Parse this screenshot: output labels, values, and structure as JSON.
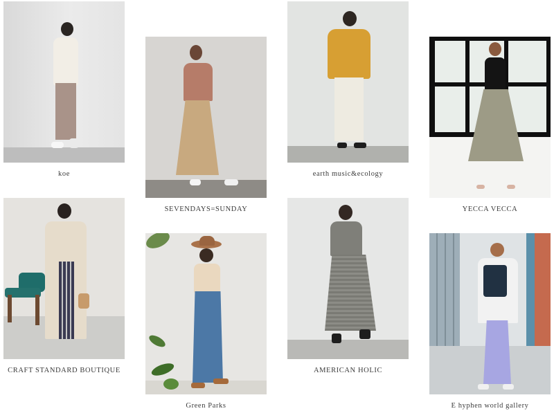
{
  "brands": [
    {
      "name": "koe"
    },
    {
      "name": "SEVENDAYS=SUNDAY"
    },
    {
      "name": "earth music&ecology"
    },
    {
      "name": "YECCA VECCA"
    },
    {
      "name": "CRAFT STANDARD BOUTIQUE"
    },
    {
      "name": "Green Parks"
    },
    {
      "name": "AMERICAN HOLIC"
    },
    {
      "name": "E hyphen world gallery"
    }
  ]
}
